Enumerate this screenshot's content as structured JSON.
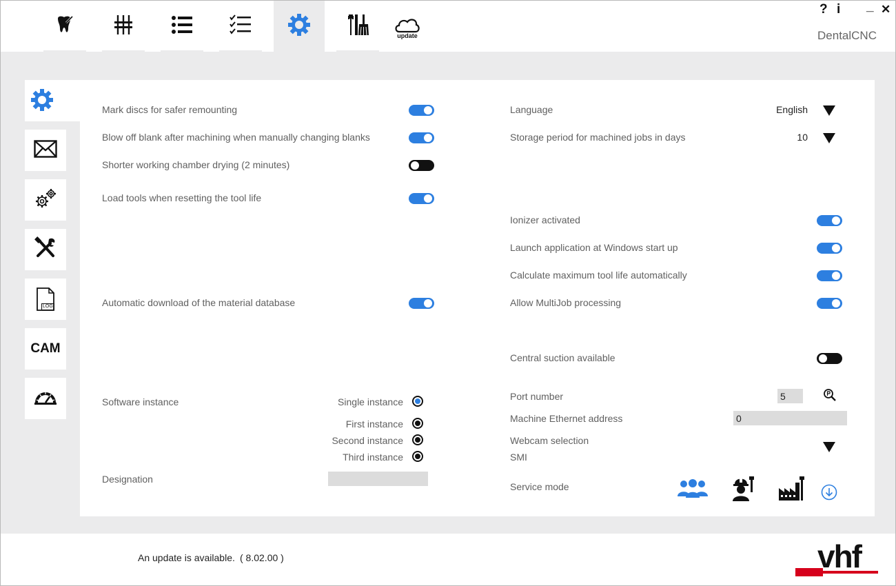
{
  "app": {
    "name": "DentalCNC"
  },
  "window_controls": {
    "help": "?",
    "info": "i",
    "minimize": "_",
    "close": "✕"
  },
  "top_tabs": [
    {
      "name": "tooth-tab",
      "icon": "tooth-icon"
    },
    {
      "name": "controls-tab",
      "icon": "sliders-icon"
    },
    {
      "name": "job-list-tab",
      "icon": "list-icon"
    },
    {
      "name": "checklist-tab",
      "icon": "checklist-icon"
    },
    {
      "name": "settings-tab",
      "icon": "gear-icon",
      "active": true
    },
    {
      "name": "maintenance-tab",
      "icon": "tools-brush-icon"
    },
    {
      "name": "update-tab",
      "icon": "cloud-update-icon",
      "label": "update"
    }
  ],
  "side_tabs": [
    {
      "icon": "gear-icon",
      "active": true
    },
    {
      "icon": "envelope-icon"
    },
    {
      "icon": "gears-icon"
    },
    {
      "icon": "wrench-screwdriver-icon"
    },
    {
      "icon": "log-file-icon",
      "label": "LOG"
    },
    {
      "icon": "cam-icon",
      "label": "CAM"
    },
    {
      "icon": "gauge-icon"
    }
  ],
  "left_settings": {
    "mark_discs": {
      "label": "Mark discs for safer remounting",
      "on": true
    },
    "blow_off": {
      "label": "Blow off blank after machining when manually changing blanks",
      "on": true
    },
    "shorter_drying": {
      "label": "Shorter working chamber drying (2 minutes)",
      "on": false
    },
    "load_tools": {
      "label": "Load tools when resetting the tool life",
      "on": true
    },
    "auto_download": {
      "label": "Automatic download of the material database",
      "on": true
    },
    "software_instance": {
      "label": "Software instance",
      "options": [
        "Single instance",
        "First instance",
        "Second instance",
        "Third instance"
      ],
      "selected": "Single instance"
    },
    "designation": {
      "label": "Designation",
      "value": ""
    }
  },
  "right_settings": {
    "language": {
      "label": "Language",
      "value": "English"
    },
    "storage_period": {
      "label": "Storage period for machined jobs in days",
      "value": "10"
    },
    "ionizer": {
      "label": "Ionizer activated",
      "on": true
    },
    "launch_startup": {
      "label": "Launch application at Windows start up",
      "on": true
    },
    "calc_tool_life": {
      "label": "Calculate maximum tool life automatically",
      "on": true
    },
    "multijob": {
      "label": "Allow MultiJob processing",
      "on": true
    },
    "central_suction": {
      "label": "Central suction available",
      "on": false
    },
    "port_number": {
      "label": "Port number",
      "value": "5"
    },
    "ethernet": {
      "label": "Machine Ethernet address",
      "value": "0"
    },
    "webcam": {
      "label": "Webcam selection"
    },
    "smi": {
      "label": "SMI"
    },
    "service_mode": {
      "label": "Service mode"
    }
  },
  "footer": {
    "update_message": "An update is available.",
    "update_version": "( 8.02.00 )",
    "logo_text": "vhf",
    "logo_color": "#d6001c"
  },
  "colors": {
    "accent": "#2d7fe0",
    "background": "#ebebec"
  }
}
